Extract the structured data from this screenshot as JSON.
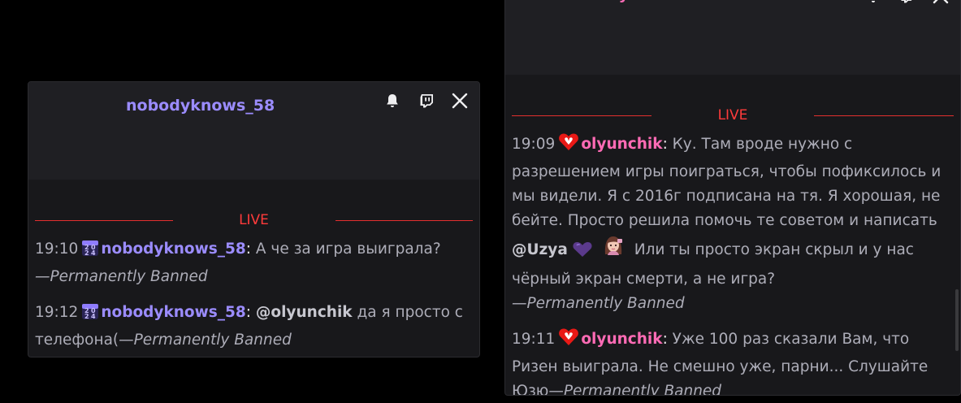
{
  "left_card": {
    "username": "nobodyknows_58",
    "username_color": "#9b8cff",
    "live_label": "LIVE",
    "messages": [
      {
        "time": "19:10",
        "badge": "calendar-2024-badge",
        "user": "nobodyknows_58",
        "colon": ":",
        "text": " А че за игра выиграла?",
        "ban": "—Permanently Banned"
      },
      {
        "time": "19:12",
        "badge": "calendar-2024-badge",
        "user": "nobodyknows_58",
        "colon": ":",
        "mention": "@olyunchik",
        "text": " да я просто с телефона(",
        "ban": "—Permanently Banned"
      }
    ]
  },
  "right_card": {
    "username": "olyunchik",
    "username_color": "#ff6bb5",
    "live_label": "LIVE",
    "messages": [
      {
        "time": "19:09",
        "badge": "heart-badge",
        "user": "olyunchik",
        "colon": ":",
        "text_a": " Ку. Там вроде нужно с разрешением игры поиграться, чтобы пофиксилось и мы видели. Я с 2016г подписана на тя. Я хорошая, не бейте. Просто решила помочь те советом и написать ",
        "mention": "@Uzya",
        "text_b": " Или ты просто экран скрыл и у нас чёрный экран смерти, а не игра?",
        "ban": "—Permanently Banned"
      },
      {
        "time": "19:11",
        "badge": "heart-badge",
        "user": "olyunchik",
        "colon": ":",
        "text": " Уже 100 раз сказали Вам, что Ризен выиграла. Не смешно уже, парни... Слушайте Юзю",
        "ban": "—Permanently Banned"
      }
    ]
  },
  "icons": [
    "bell-icon",
    "twitch-icon",
    "close-icon",
    "purple-heart-emote",
    "girl-avatar-emote"
  ],
  "colors": {
    "live": "#ff3b3b",
    "live_line": "#e32f2f",
    "text": "#adadb8",
    "card_bg": "#18181b",
    "head_bg": "#1f1f23",
    "badge_red": "#e91916"
  }
}
